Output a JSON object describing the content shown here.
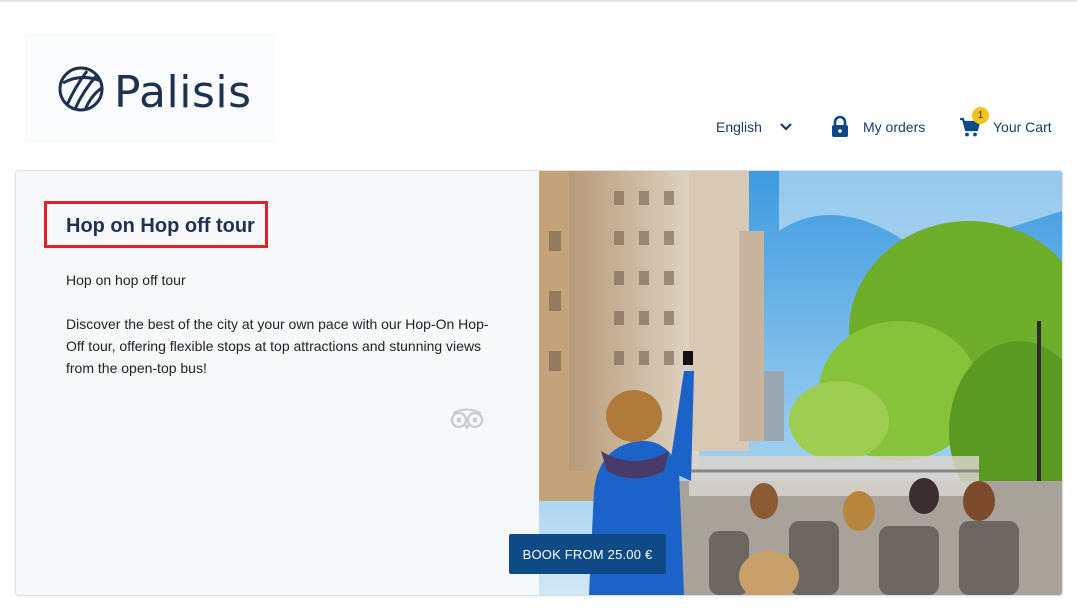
{
  "brand": {
    "name": "Palisis"
  },
  "header": {
    "language": "English",
    "orders_label": "My orders",
    "cart_label": "Your Cart",
    "cart_count": "1"
  },
  "tour": {
    "title": "Hop on Hop off tour",
    "subtitle": "Hop on hop off tour",
    "description": "Discover the best of the city at your own pace with our Hop-On Hop-Off tour, offering flexible stops at top attractions and stunning views from the open-top bus!",
    "book_label": "BOOK FROM 25.00 €"
  },
  "colors": {
    "brand_navy": "#1f3150",
    "button_blue": "#0d4a86",
    "highlight_red": "#e4212b",
    "badge_yellow": "#f4c21b"
  },
  "icons": [
    "globe-logo-icon",
    "chevron-down-icon",
    "lock-icon",
    "cart-icon",
    "tripadvisor-icon"
  ]
}
